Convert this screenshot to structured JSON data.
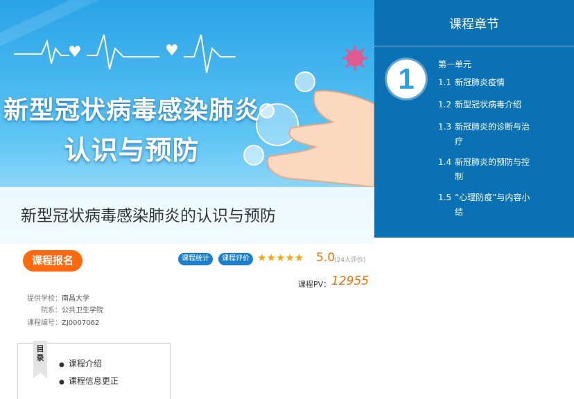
{
  "banner": {
    "title_line1": "新型冠状病毒感染肺炎",
    "title_line2": "认识与预防",
    "subtitle": "新型冠状病毒感染肺炎的认识与预防"
  },
  "sidebar": {
    "heading": "课程章节",
    "unit_number": "1",
    "unit_title": "第一单元",
    "chapters": [
      {
        "num": "1.1",
        "title": "新冠肺炎疫情"
      },
      {
        "num": "1.2",
        "title": "新型冠状病毒介绍"
      },
      {
        "num": "1.3",
        "title": "新冠肺炎的诊断与治疗"
      },
      {
        "num": "1.4",
        "title": "新冠肺炎的预防与控制"
      },
      {
        "num": "1.5",
        "title": "“心理防疫”与内容小结"
      }
    ]
  },
  "actions": {
    "enroll": "课程报名",
    "stats": "课程统计",
    "review": "课程评价"
  },
  "rating": {
    "stars": "★★★★★",
    "score": "5.0",
    "count": "(24人评价)"
  },
  "pv": {
    "label": "课程PV：",
    "value": "12955"
  },
  "info": {
    "school_label": "提供学校：",
    "school": "南昌大学",
    "dept_label": "院系：",
    "dept": "公共卫生学院",
    "code_label": "课程编号：",
    "code": "ZJ0007062"
  },
  "toc": {
    "tab": "目录",
    "items": [
      "课程介绍",
      "课程信息更正"
    ]
  },
  "colors": {
    "sidebar_bg": "#0a72b4",
    "enroll_bg": "#ff6a0e",
    "accent_orange": "#f07000",
    "pill_bg": "#1b7fd0",
    "star": "#f6a80b"
  }
}
